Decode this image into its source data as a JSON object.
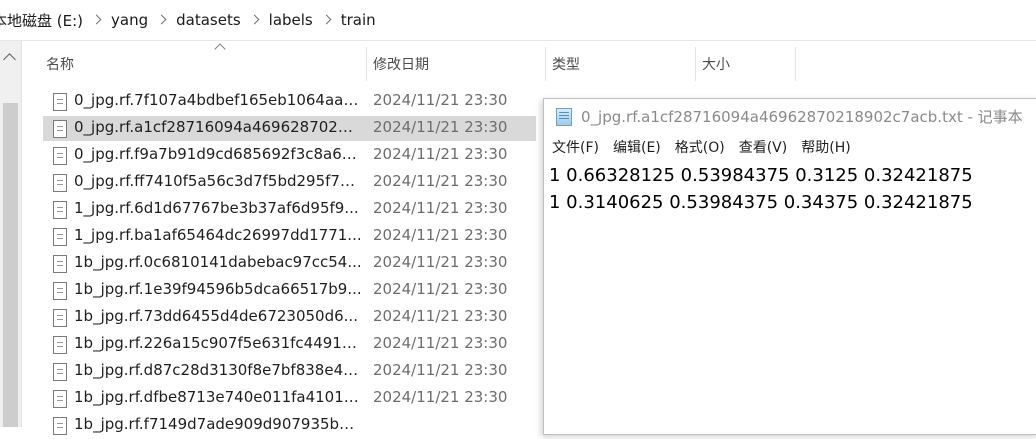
{
  "address_bar": {
    "crumbs": [
      "本地磁盘 (E:)",
      "yang",
      "datasets",
      "labels",
      "train"
    ]
  },
  "columns": {
    "name": "名称",
    "modified": "修改日期",
    "type": "类型",
    "size": "大小"
  },
  "files": [
    {
      "name": "0_jpg.rf.7f107a4bdbef165eb1064aae...",
      "date": "2024/11/21 23:30"
    },
    {
      "name": "0_jpg.rf.a1cf28716094a46962870218...",
      "date": "2024/11/21 23:30"
    },
    {
      "name": "0_jpg.rf.f9a7b91d9cd685692f3c8a60...",
      "date": "2024/11/21 23:30"
    },
    {
      "name": "0_jpg.rf.ff7410f5a56c3d7f5bd295f7c...",
      "date": "2024/11/21 23:30"
    },
    {
      "name": "1_jpg.rf.6d1d67767be3b37af6d95f9...",
      "date": "2024/11/21 23:30"
    },
    {
      "name": "1_jpg.rf.ba1af65464dc26997dd1771...",
      "date": "2024/11/21 23:30"
    },
    {
      "name": "1b_jpg.rf.0c6810141dabebac97cc54...",
      "date": "2024/11/21 23:30"
    },
    {
      "name": "1b_jpg.rf.1e39f94596b5dca66517b9...",
      "date": "2024/11/21 23:30"
    },
    {
      "name": "1b_jpg.rf.73dd6455d4de6723050d6...",
      "date": "2024/11/21 23:30"
    },
    {
      "name": "1b_jpg.rf.226a15c907f5e631fc44912...",
      "date": "2024/11/21 23:30"
    },
    {
      "name": "1b_jpg.rf.d87c28d3130f8e7bf838e4a...",
      "date": "2024/11/21 23:30"
    },
    {
      "name": "1b_jpg.rf.dfbe8713e740e011fa41010...",
      "date": "2024/11/21 23:30"
    },
    {
      "name": "1b_jpg.rf.f7149d7ade909d907935b8...",
      "date": ""
    }
  ],
  "selected_index": 1,
  "notepad": {
    "title": "0_jpg.rf.a1cf28716094a46962870218902c7acb.txt - 记事本",
    "menu": [
      "文件(F)",
      "编辑(E)",
      "格式(O)",
      "查看(V)",
      "帮助(H)"
    ],
    "lines": [
      "1 0.66328125 0.53984375 0.3125 0.32421875",
      "1 0.3140625 0.53984375 0.34375 0.32421875"
    ]
  }
}
